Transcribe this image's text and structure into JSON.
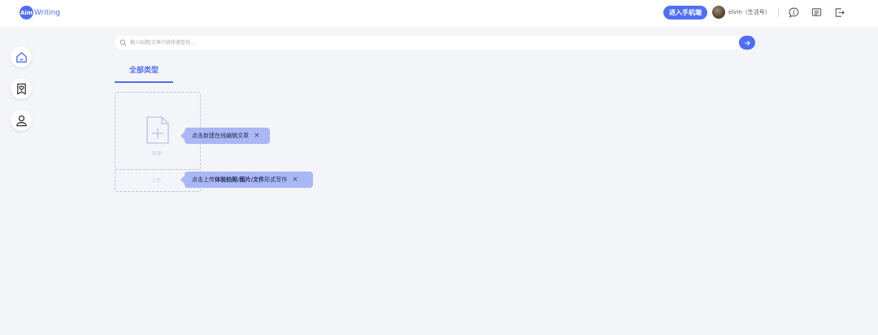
{
  "header": {
    "logo_badge": "Aim",
    "logo_text": "Writing",
    "mobile_button": "进入手机端",
    "username": "elvin（生活号）"
  },
  "search": {
    "placeholder": "输入标题/文章内容快速查找..."
  },
  "tabs": [
    {
      "label": "全部类型",
      "active": true
    }
  ],
  "cards": {
    "new_label": "新建",
    "upload_label": "上传"
  },
  "tooltips": {
    "new_tip": "点击新建在线编辑文章",
    "upload_tip_prefix": "点击上传",
    "upload_tip_bold": "体验拍照/图片/文件",
    "upload_tip_suffix": "形式写作",
    "close_symbol": "×"
  },
  "icons": {
    "rail": [
      "home-icon",
      "bookmark-heart-icon",
      "user-icon"
    ],
    "top": [
      "feedback-icon",
      "message-icon",
      "logout-icon"
    ]
  },
  "colors": {
    "accent": "#4f6ef7",
    "tooltip_bg": "#a9b7f5",
    "dashed_border": "#b9c6f4",
    "page_bg": "#f4f5f9"
  }
}
